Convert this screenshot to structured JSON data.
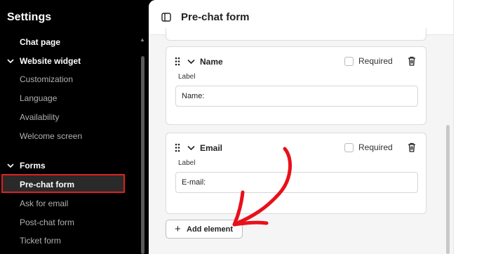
{
  "sidebar": {
    "title": "Settings",
    "chat_page": "Chat page",
    "website_widget": "Website widget",
    "widget_items": [
      "Customization",
      "Language",
      "Availability",
      "Welcome screen"
    ],
    "forms": "Forms",
    "form_items": [
      "Pre-chat form",
      "Ask for email",
      "Post-chat form",
      "Ticket form"
    ]
  },
  "header": {
    "title": "Pre-chat form"
  },
  "fields": [
    {
      "name": "Name",
      "required_label": "Required",
      "label_caption": "Label",
      "value": "Name:"
    },
    {
      "name": "Email",
      "required_label": "Required",
      "label_caption": "Label",
      "value": "E-mail:"
    }
  ],
  "add_element": {
    "label": "Add element"
  },
  "colors": {
    "highlight": "#e02020",
    "arrow": "#e8101a"
  }
}
